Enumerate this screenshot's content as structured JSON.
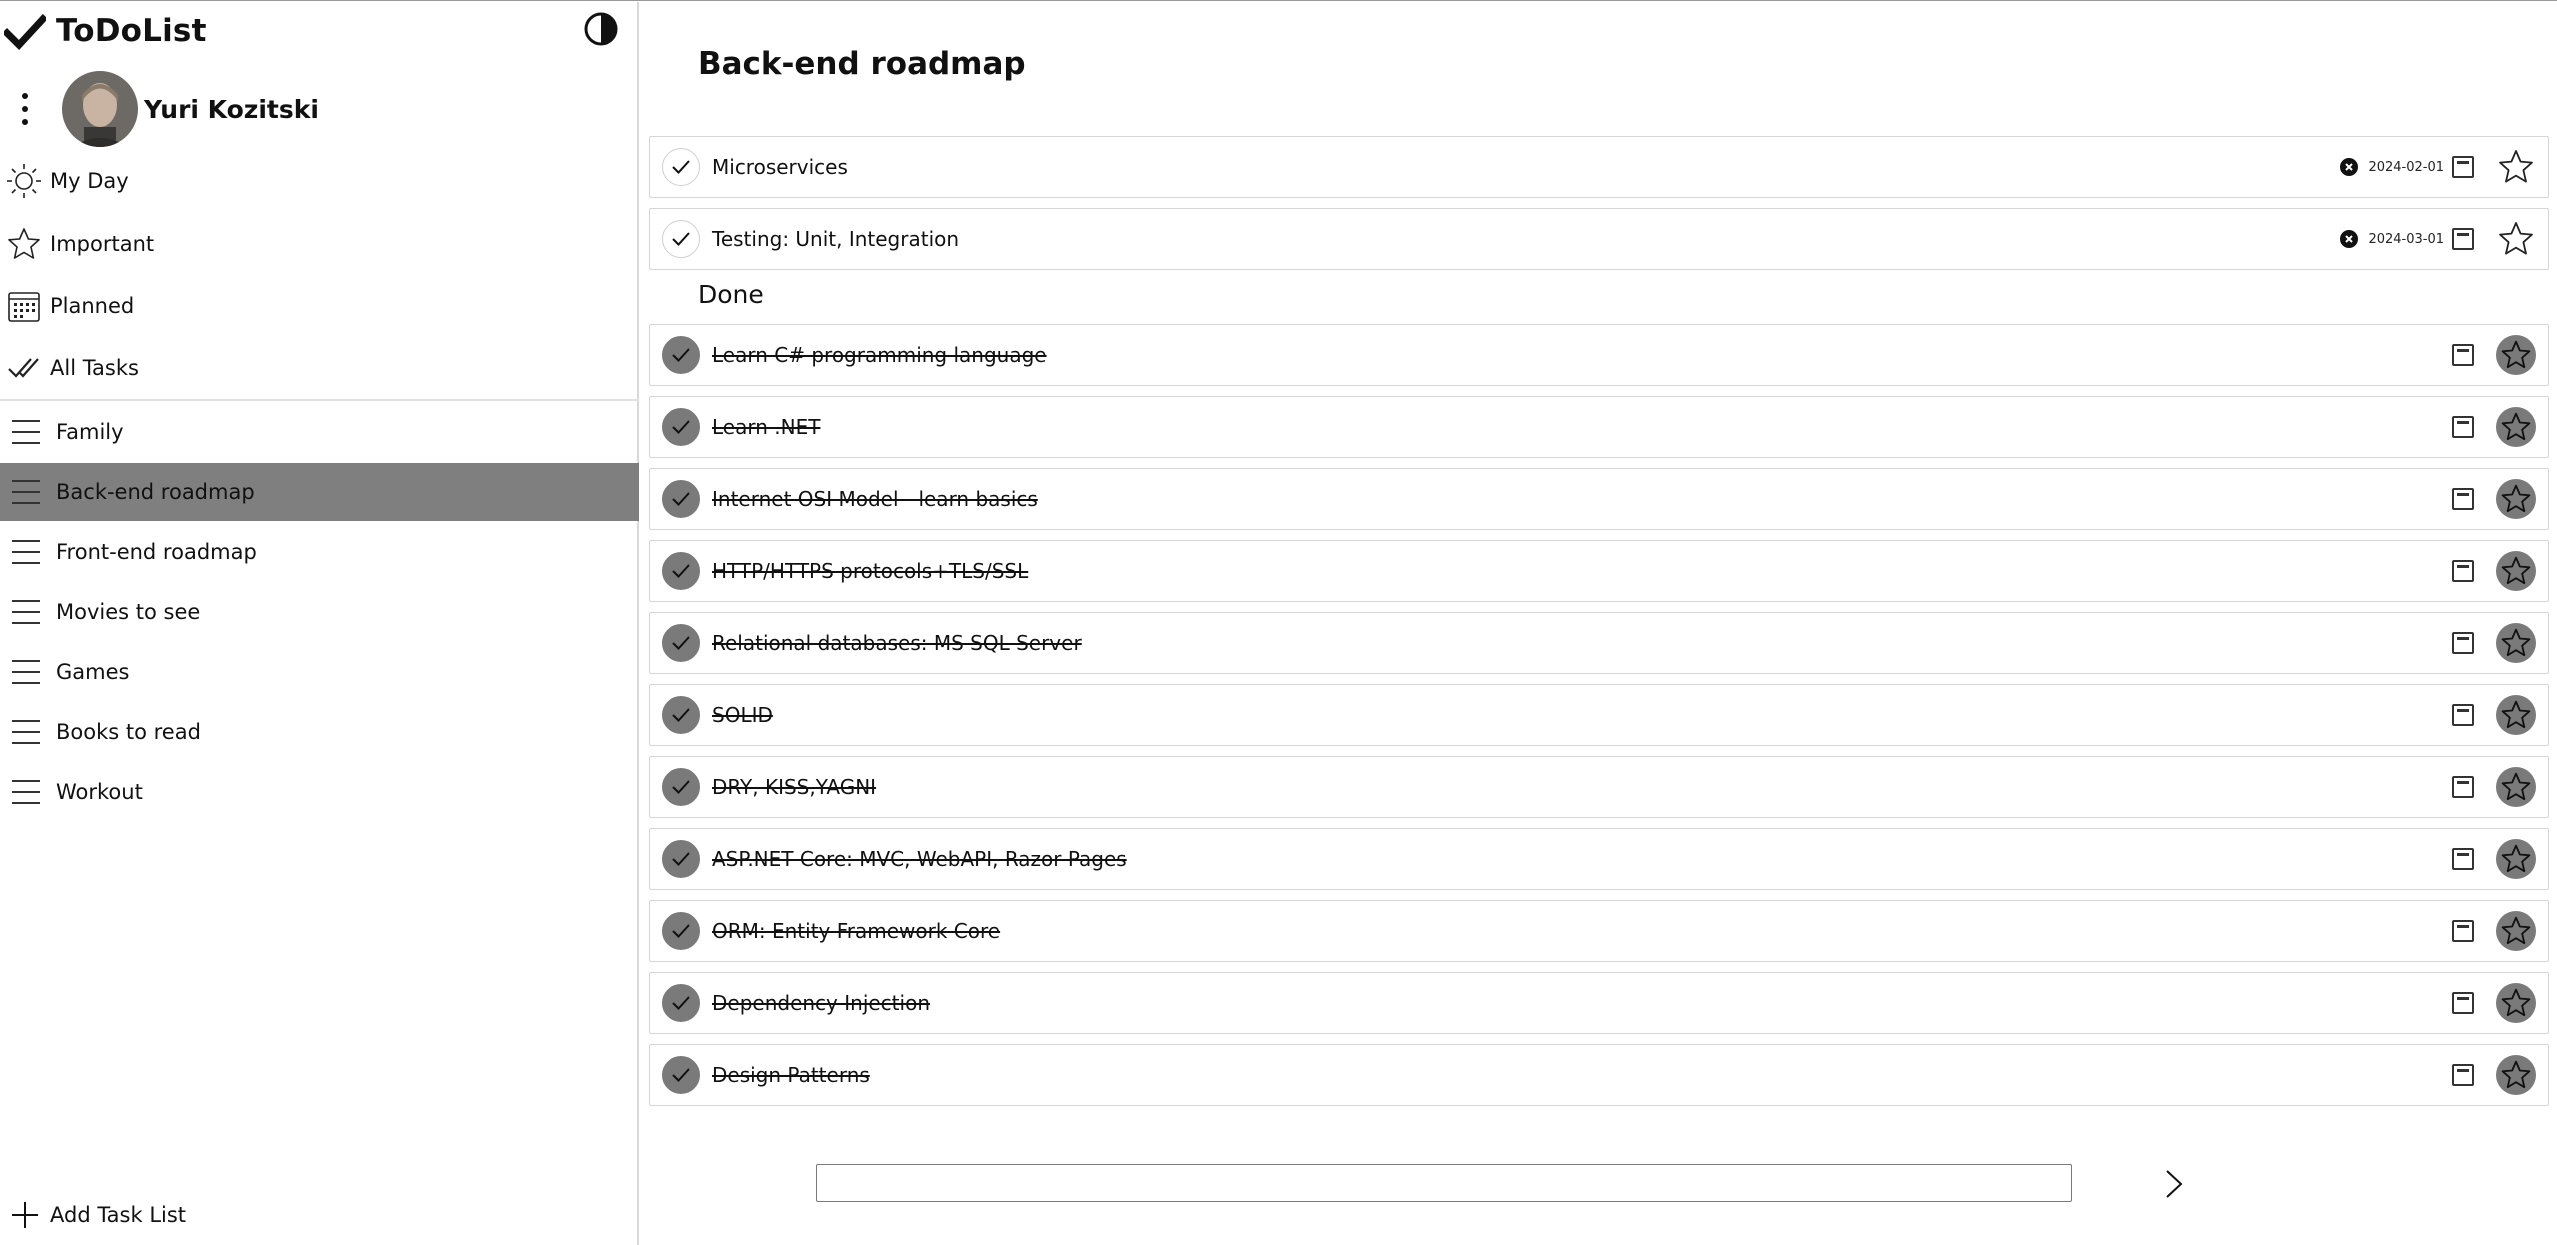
{
  "app": {
    "title": "ToDoList"
  },
  "user": {
    "name": "Yuri Kozitski"
  },
  "nav": [
    {
      "label": "My Day",
      "icon": "sun-icon"
    },
    {
      "label": "Important",
      "icon": "star-icon"
    },
    {
      "label": "Planned",
      "icon": "calendar-icon"
    },
    {
      "label": "All Tasks",
      "icon": "double-check-icon"
    }
  ],
  "lists": [
    {
      "label": "Family",
      "active": false
    },
    {
      "label": "Back-end roadmap",
      "active": true
    },
    {
      "label": "Front-end roadmap",
      "active": false
    },
    {
      "label": "Movies to see",
      "active": false
    },
    {
      "label": "Games",
      "active": false
    },
    {
      "label": "Books to read",
      "active": false
    },
    {
      "label": "Workout",
      "active": false
    }
  ],
  "sidebar": {
    "add_list_label": "Add Task List"
  },
  "main": {
    "title": "Back-end roadmap",
    "pending": [
      {
        "text": "Microservices",
        "due": "2024-02-01"
      },
      {
        "text": "Testing: Unit, Integration",
        "due": "2024-03-01"
      }
    ],
    "done_heading": "Done",
    "done": [
      {
        "text": "Learn C# programming language"
      },
      {
        "text": "Learn .NET"
      },
      {
        "text": "Internet OSI Model - learn basics"
      },
      {
        "text": "HTTP/HTTPS protocols+TLS/SSL"
      },
      {
        "text": "Relational databases: MS SQL Server"
      },
      {
        "text": "SOLID"
      },
      {
        "text": "DRY, KISS,YAGNI"
      },
      {
        "text": "ASP.NET Core: MVC, WebAPI, Razor Pages"
      },
      {
        "text": "ORM: Entity Framework Core"
      },
      {
        "text": "Dependency Injection"
      },
      {
        "text": "Design Patterns"
      }
    ],
    "new_task_value": ""
  },
  "colors": {
    "active_bg": "#7f7f7f",
    "done_fill": "#7a7a7a",
    "border": "#d6d6d6"
  }
}
